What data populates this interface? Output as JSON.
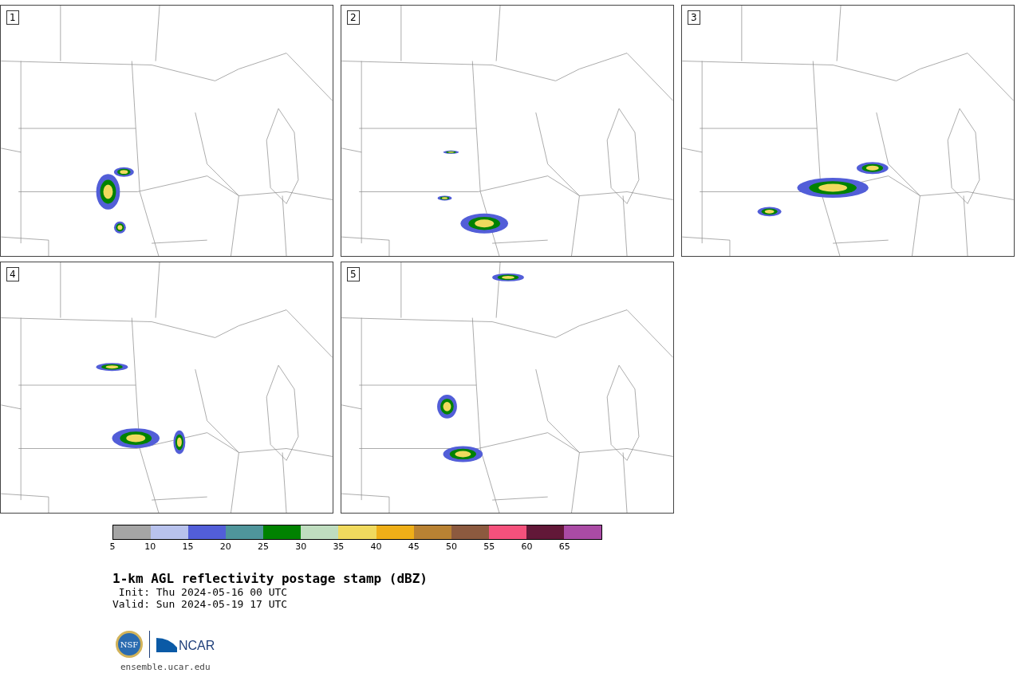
{
  "panels": [
    {
      "label": "1"
    },
    {
      "label": "2"
    },
    {
      "label": "3"
    },
    {
      "label": "4"
    },
    {
      "label": "5"
    }
  ],
  "colorbar": {
    "bins": [
      {
        "color": "#a5a5a5"
      },
      {
        "color": "#b8c2ed"
      },
      {
        "color": "#525ed8"
      },
      {
        "color": "#4f959b"
      },
      {
        "color": "#008200"
      },
      {
        "color": "#bfddbf"
      },
      {
        "color": "#f0da5e"
      },
      {
        "color": "#efaf18"
      },
      {
        "color": "#b98233"
      },
      {
        "color": "#8c5a3f"
      },
      {
        "color": "#f5517c"
      },
      {
        "color": "#621838"
      },
      {
        "color": "#aa4ba5"
      }
    ],
    "ticks": [
      "5",
      "10",
      "15",
      "20",
      "25",
      "30",
      "35",
      "40",
      "45",
      "50",
      "55",
      "60",
      "65"
    ]
  },
  "title": "1-km AGL reflectivity postage stamp (dBZ)",
  "init": " Init: Thu 2024-05-16 00 UTC",
  "valid": "Valid: Sun 2024-05-19 17 UTC",
  "logo": {
    "left": "NSF",
    "right": "NCAR"
  },
  "footer_link": "ensemble.ucar.edu"
}
